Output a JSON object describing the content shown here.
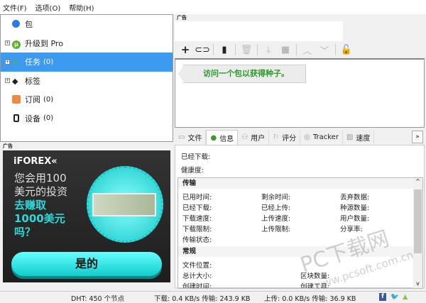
{
  "menu": [
    "文件(F)",
    "选项(O)",
    "帮助(H)"
  ],
  "tree": [
    {
      "label": "包",
      "count": "",
      "icon": "bundle-icon",
      "expand": false
    },
    {
      "label": "升级到 Pro",
      "count": "",
      "icon": "utorrent-logo-icon",
      "expand": true
    },
    {
      "label": "任务",
      "count": "(0)",
      "icon": "torrents-icon",
      "expand": true,
      "selected": true
    },
    {
      "label": "标签",
      "count": "",
      "icon": "tag-icon",
      "expand": true
    },
    {
      "label": "订阅",
      "count": "(0)",
      "icon": "rss-icon",
      "expand": false
    },
    {
      "label": "设备",
      "count": "(0)",
      "icon": "device-icon",
      "expand": false
    }
  ],
  "ad_label": "广告",
  "ad": {
    "logo": "iFOREX«",
    "line1": "您会用100",
    "line2": "美元的投资",
    "line3": "去赚取",
    "line4": "1000美元",
    "line5": "吗？",
    "button": "是的"
  },
  "list_hint": "访问一个包以获得种子。",
  "tabs": [
    "文件",
    "信息",
    "用户",
    "评分",
    "Tracker",
    "速度"
  ],
  "info": {
    "downloaded": "已经下载:",
    "health": "健康度:",
    "transfer_title": "传输",
    "transfer": [
      "已用时间:",
      "剩余时间:",
      "丢弃数据:",
      "已经下载:",
      "已经上传:",
      "种源数量:",
      "下载速度:",
      "上传速度:",
      "用户数量:",
      "下载限制:",
      "上传限制:",
      "分享率:",
      "传输状态:",
      "",
      ""
    ],
    "general_title": "常规",
    "general": [
      "文件位置:",
      "",
      "",
      "总计大小:",
      "区块数量:",
      "",
      "创建时间:",
      "创建工具:",
      ""
    ]
  },
  "status": {
    "dht": "DHT: 450 个节点",
    "down": "下载: 0.4 KB/s 传输: 243.9 KB",
    "up": "上传: 0.0 KB/s 传输: 36.9 KB"
  },
  "watermark": {
    "main": "PC下载网",
    "url": "www.pcsoft.com.cn"
  },
  "colors": {
    "selection": "#3c9af0",
    "hint_text": "#2a9a2a",
    "ad_accent": "#2fd8d8"
  }
}
